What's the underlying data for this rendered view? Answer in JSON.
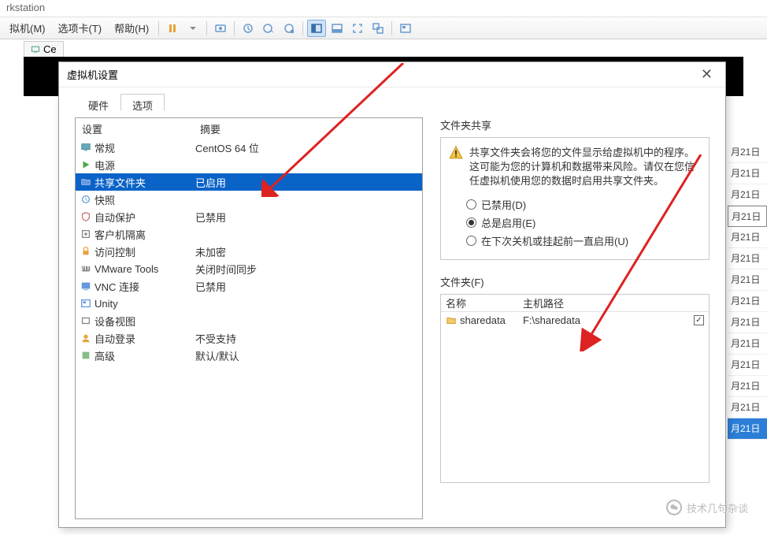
{
  "title_bar": "rkstation",
  "menu": {
    "vm": "拟机(M)",
    "tabs": "选项卡(T)",
    "help": "帮助(H)"
  },
  "tab": {
    "label": "Ce"
  },
  "dialog": {
    "title": "虚拟机设置",
    "tabs": {
      "hardware": "硬件",
      "options": "选项"
    },
    "headers": {
      "setting": "设置",
      "summary": "摘要"
    },
    "rows": {
      "general": {
        "label": "常规",
        "summary": "CentOS 64 位"
      },
      "power": {
        "label": "电源",
        "summary": ""
      },
      "shared_folders": {
        "label": "共享文件夹",
        "summary": "已启用"
      },
      "snapshot": {
        "label": "快照",
        "summary": ""
      },
      "auto_protect": {
        "label": "自动保护",
        "summary": "已禁用"
      },
      "guest_isolation": {
        "label": "客户机隔离",
        "summary": ""
      },
      "access_control": {
        "label": "访问控制",
        "summary": "未加密"
      },
      "vmware_tools": {
        "label": "VMware Tools",
        "summary": "关闭时间同步"
      },
      "vnc": {
        "label": "VNC 连接",
        "summary": "已禁用"
      },
      "unity": {
        "label": "Unity",
        "summary": ""
      },
      "device_view": {
        "label": "设备视图",
        "summary": ""
      },
      "auto_login": {
        "label": "自动登录",
        "summary": "不受支持"
      },
      "advanced": {
        "label": "高级",
        "summary": "默认/默认"
      }
    }
  },
  "right": {
    "share_label": "文件夹共享",
    "warning": "共享文件夹会将您的文件显示给虚拟机中的程序。这可能为您的计算机和数据带来风险。请仅在您信任虚拟机使用您的数据时启用共享文件夹。",
    "opt_disabled": "已禁用(D)",
    "opt_always": "总是启用(E)",
    "opt_until": "在下次关机或挂起前一直启用(U)",
    "folders_label": "文件夹(F)",
    "folders_hdr": {
      "name": "名称",
      "host": "主机路径"
    },
    "folder_row": {
      "name": "sharedata",
      "path": "F:\\sharedata"
    }
  },
  "side_dates": [
    "月21日",
    "月21日",
    "月21日",
    "月21日",
    "月21日",
    "月21日",
    "月21日",
    "月21日",
    "月21日",
    "月21日",
    "月21日",
    "月21日",
    "月21日",
    "月21日"
  ],
  "watermark": "技术几句杂谈"
}
